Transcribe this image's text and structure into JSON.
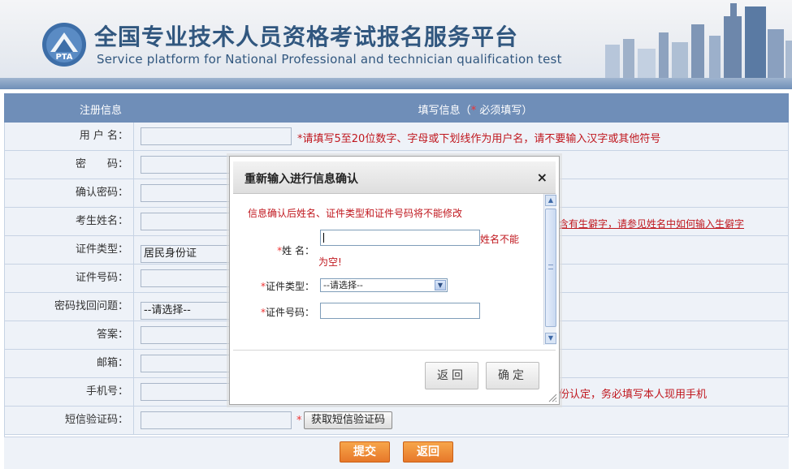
{
  "header": {
    "title_cn": "全国专业技术人员资格考试报名服务平台",
    "title_en": "Service platform for National Professional and technician  qualification test",
    "logo_text": "PTA"
  },
  "table_head": {
    "left": "注册信息",
    "right_prefix": "填写信息（",
    "right_star": "*",
    "right_suffix": " 必须填写）"
  },
  "rows": [
    {
      "label": "用 户 名：",
      "value": "",
      "hint": "*请填写5至20位数字、字母或下划线作为用户名，请不要输入汉字或其他符号"
    },
    {
      "label": "密　　码：",
      "value": "",
      "hint": ""
    },
    {
      "label": "确认密码：",
      "value": "",
      "hint": ""
    },
    {
      "label": "考生姓名：",
      "value": "",
      "hint": "含有生僻字，请参见姓名中如何输入生僻字"
    },
    {
      "label": "证件类型：",
      "value": "居民身份证",
      "hint": ""
    },
    {
      "label": "证件号码：",
      "value": "",
      "hint": ""
    },
    {
      "label": "密码找回问题：",
      "value": "--请选择--",
      "hint": ""
    },
    {
      "label": "答案：",
      "value": "",
      "hint": ""
    },
    {
      "label": "邮箱：",
      "value": "",
      "hint": ""
    },
    {
      "label": "手机号：",
      "value": "",
      "hint": "份认定，务必填写本人现用手机"
    },
    {
      "label": "短信验证码：",
      "value": "",
      "hint": ""
    }
  ],
  "sms": {
    "star": "*",
    "button": "获取短信验证码"
  },
  "footer": {
    "submit": "提交",
    "back": "返回"
  },
  "modal": {
    "title": "重新输入进行信息确认",
    "close": "×",
    "warning": "信息确认后姓名、证件类型和证件号码将不能修改",
    "name_label": "姓 名：",
    "name_error_1": "姓名不能",
    "name_error_2": "为空!",
    "id_type_label": "证件类型：",
    "id_type_value": "--请选择--",
    "id_number_label": "证件号码：",
    "star": "*",
    "back_button": "返回",
    "confirm_button": "确定"
  },
  "colors": {
    "accent": "#6f8eb8",
    "error": "#c0171e",
    "button_orange": "#e7782a"
  }
}
